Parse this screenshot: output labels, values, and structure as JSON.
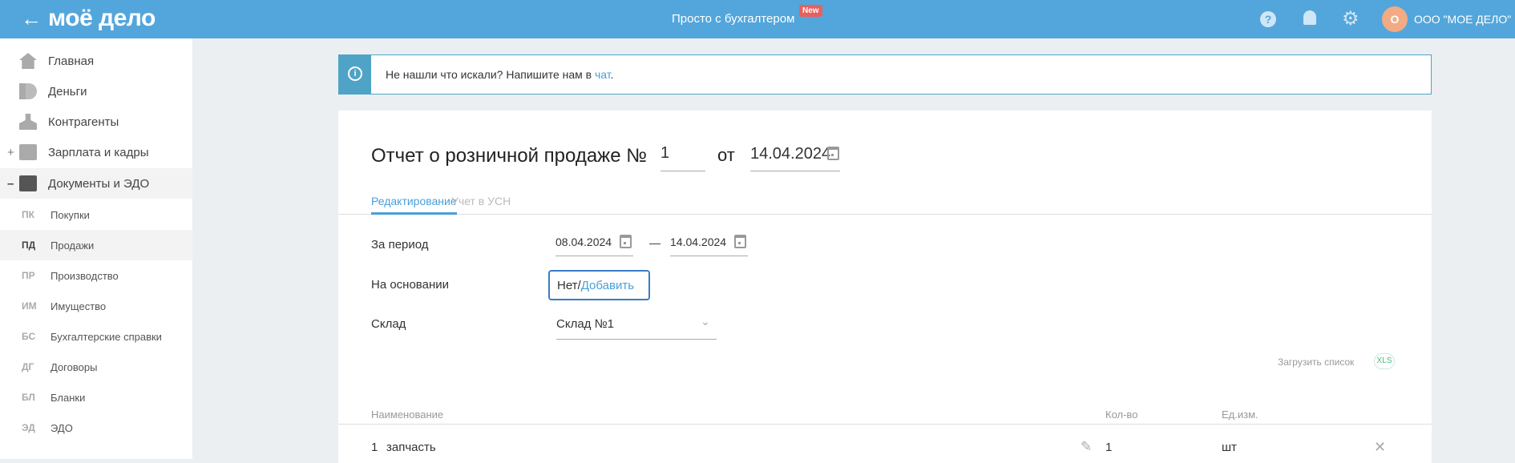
{
  "header": {
    "logo": "моё дело",
    "center_link": "Просто с бухгалтером",
    "new_badge": "New",
    "avatar_letter": "О",
    "org_name": "ООО \"МОЕ ДЕЛО\""
  },
  "sidebar": {
    "items": [
      {
        "label": "Главная",
        "icon": "home-icon"
      },
      {
        "label": "Деньги",
        "icon": "money-icon"
      },
      {
        "label": "Контрагенты",
        "icon": "contractor-icon"
      },
      {
        "label": "Зарплата и кадры",
        "icon": "wallet-icon",
        "toggle": "+"
      },
      {
        "label": "Документы и ЭДО",
        "icon": "folder-icon",
        "toggle": "–"
      }
    ],
    "subitems": [
      {
        "abbr": "ПК",
        "label": "Покупки"
      },
      {
        "abbr": "ПД",
        "label": "Продажи"
      },
      {
        "abbr": "ПР",
        "label": "Производство"
      },
      {
        "abbr": "ИМ",
        "label": "Имущество"
      },
      {
        "abbr": "БС",
        "label": "Бухгалтерские справки"
      },
      {
        "abbr": "ДГ",
        "label": "Договоры"
      },
      {
        "abbr": "БЛ",
        "label": "Бланки"
      },
      {
        "abbr": "ЭД",
        "label": "ЭДО"
      }
    ]
  },
  "banner": {
    "text": "Не нашли что искали? Напишите нам в ",
    "link": "чат",
    "suffix": "."
  },
  "doc": {
    "title": "Отчет о розничной продаже №",
    "number": "1",
    "from_label": "от",
    "date": "14.04.2024",
    "tabs": [
      "Редактирование",
      "Учет в УСН"
    ],
    "period_label": "За период",
    "period_from": "08.04.2024",
    "period_dash": "—",
    "period_to": "14.04.2024",
    "basis_label": "На основании",
    "basis_value": "Нет/",
    "basis_add": "Добавить",
    "warehouse_label": "Склад",
    "warehouse_value": "Склад №1",
    "upload_label": "Загрузить список",
    "upload_badge": "XLS"
  },
  "table": {
    "headers": [
      "Наименование",
      "Кол-во",
      "Ед.изм."
    ],
    "rows": [
      {
        "num": "1",
        "name": "запчасть",
        "qty": "1",
        "unit": "шт"
      }
    ]
  },
  "colors": {
    "header": "#53a6db",
    "accent": "#4a9fd8",
    "badge": "#e8605c",
    "avatar": "#f2ab84"
  }
}
